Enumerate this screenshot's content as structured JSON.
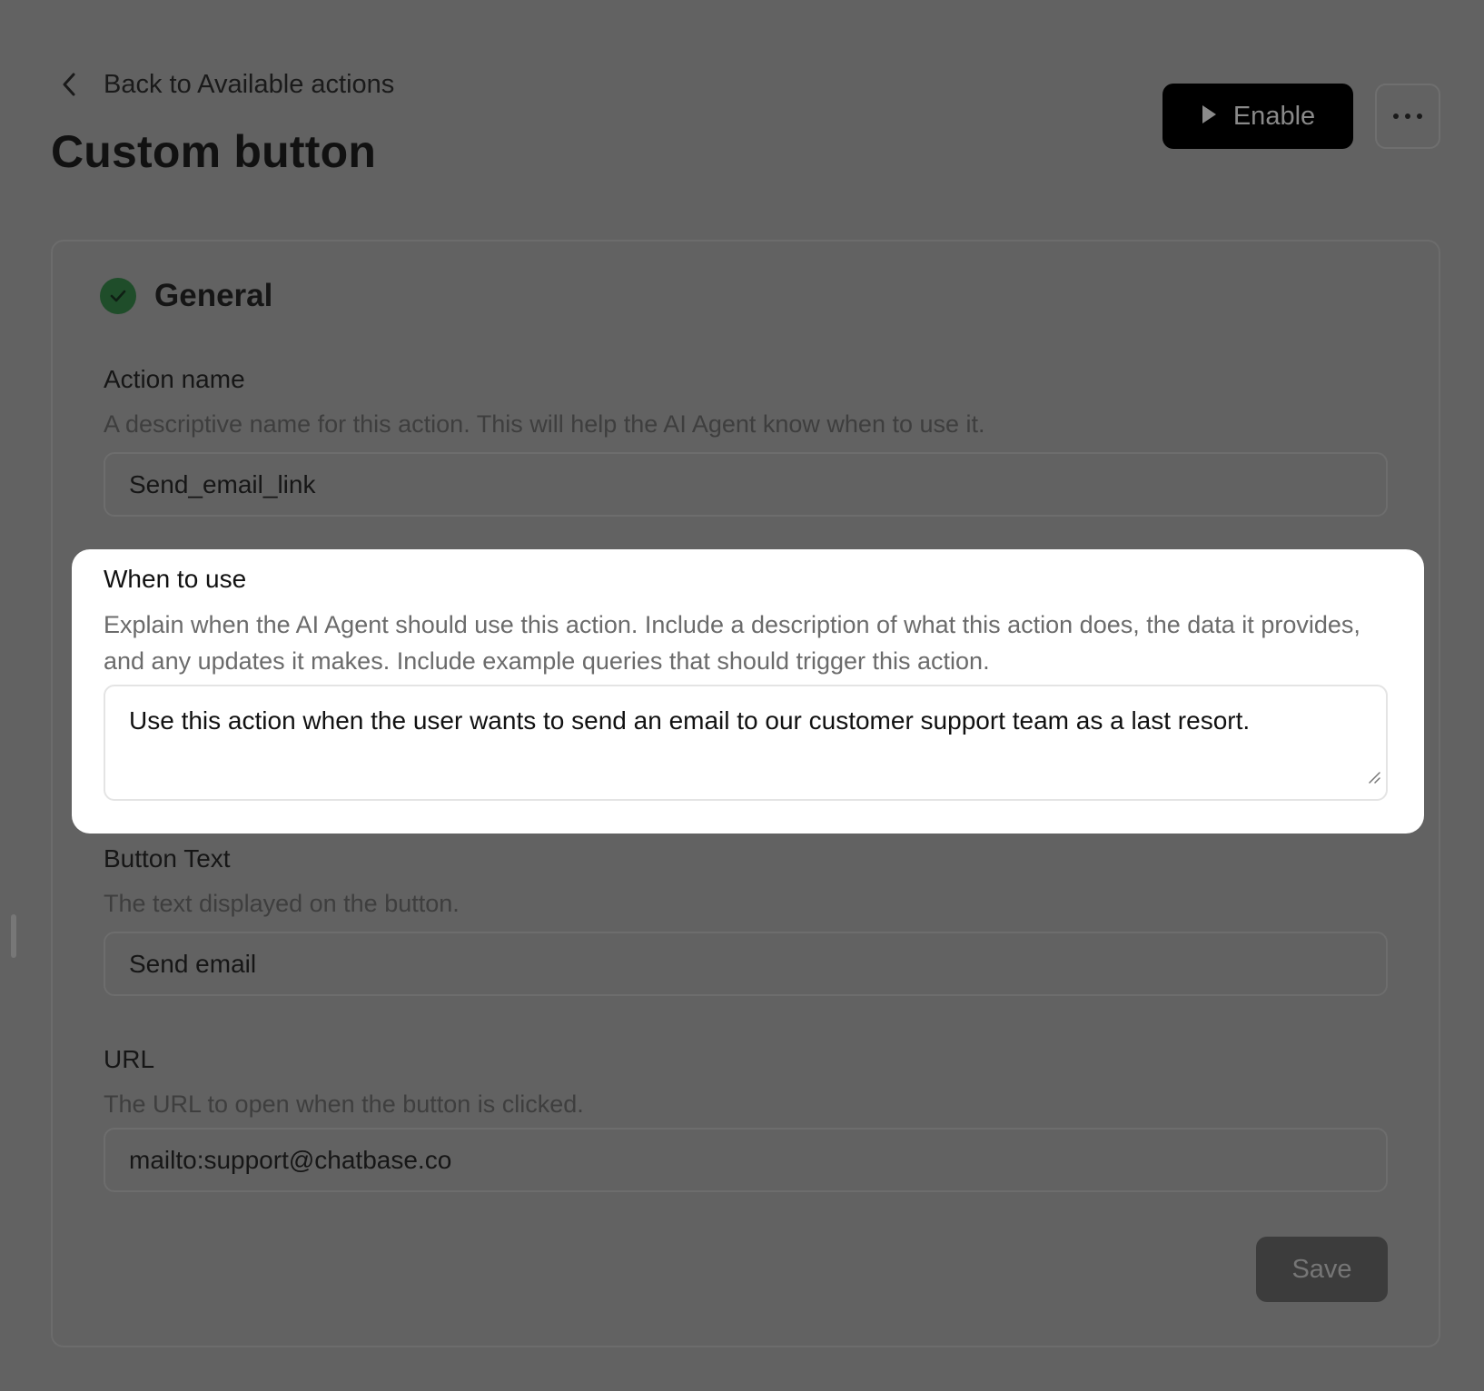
{
  "header": {
    "back_label": "Back to Available actions",
    "title": "Custom button",
    "enable_label": "Enable"
  },
  "section": {
    "title": "General",
    "check_color": "#1f4d2a"
  },
  "fields": {
    "action_name": {
      "label": "Action name",
      "help": "A descriptive name for this action. This will help the AI Agent know when to use it.",
      "value": "Send_email_link"
    },
    "when_to_use": {
      "label": "When to use",
      "help": "Explain when the AI Agent should use this action. Include a description of what this action does, the data it provides, and any updates it makes. Include example queries that should trigger this action.",
      "value": "Use this action when the user wants to send an email to our customer support team as a last resort."
    },
    "button_text": {
      "label": "Button Text",
      "help": "The text displayed on the button.",
      "value": "Send email"
    },
    "url": {
      "label": "URL",
      "help": "The URL to open when the button is clicked.",
      "value": "mailto:support@chatbase.co"
    }
  },
  "footer": {
    "save_label": "Save"
  },
  "icons": {
    "back": "chevron-left-icon",
    "enable": "play-icon",
    "more": "more-horizontal-icon",
    "section_status": "check-circle-icon",
    "resize": "resize-handle-icon"
  }
}
